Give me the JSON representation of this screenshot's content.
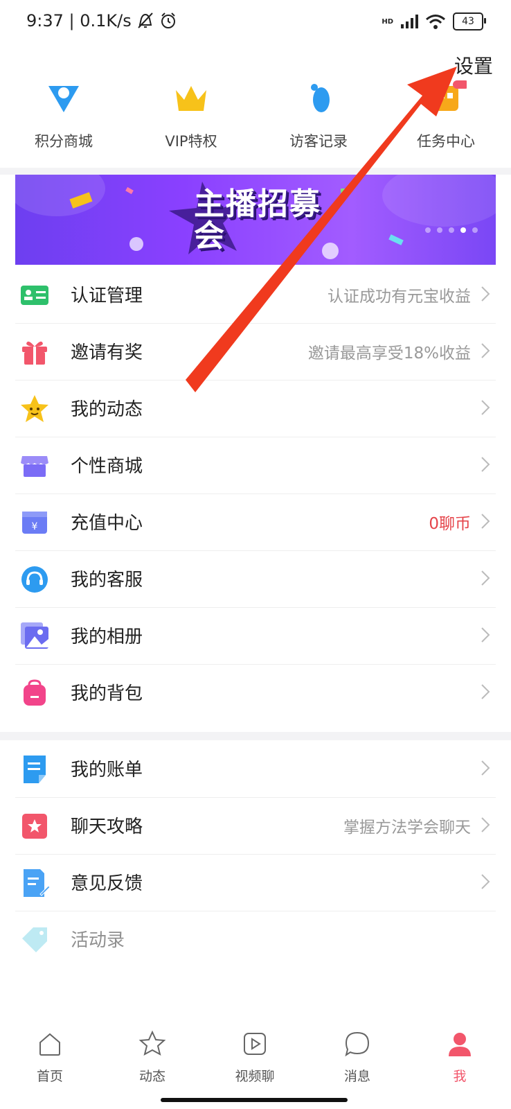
{
  "status_bar": {
    "time_speed": "9:37 | 0.1K/s",
    "network": "HD",
    "battery": "43"
  },
  "header": {
    "settings_label": "设置"
  },
  "quick_links": [
    {
      "label": "积分商城",
      "icon": "shop-heart-icon"
    },
    {
      "label": "VIP特权",
      "icon": "crown-icon"
    },
    {
      "label": "访客记录",
      "icon": "footprint-icon"
    },
    {
      "label": "任务中心",
      "icon": "task-icon"
    }
  ],
  "banner": {
    "title": "主播招募会",
    "dots": 5,
    "active_dot": 4
  },
  "menu_group_1": [
    {
      "label": "认证管理",
      "sub": "认证成功有元宝收益",
      "icon": "id-card-icon",
      "color": "#2ec06b"
    },
    {
      "label": "邀请有奖",
      "sub": "邀请最高享受18%收益",
      "icon": "gift-icon",
      "color": "#f2566b"
    },
    {
      "label": "我的动态",
      "sub": "",
      "icon": "star-face-icon",
      "color": "#f7c21a"
    },
    {
      "label": "个性商城",
      "sub": "",
      "icon": "store-icon",
      "color": "#7b6cf6"
    },
    {
      "label": "充值中心",
      "sub": "0聊币",
      "sub_highlight": true,
      "icon": "wallet-yen-icon",
      "color": "#6b7cf5"
    },
    {
      "label": "我的客服",
      "sub": "",
      "icon": "headset-icon",
      "color": "#2d9bf0"
    },
    {
      "label": "我的相册",
      "sub": "",
      "icon": "photo-album-icon",
      "color": "#6b6cf0"
    },
    {
      "label": "我的背包",
      "sub": "",
      "icon": "backpack-icon",
      "color": "#f2448a"
    }
  ],
  "menu_group_2": [
    {
      "label": "我的账单",
      "sub": "",
      "icon": "bill-icon",
      "color": "#2d9bf0"
    },
    {
      "label": "聊天攻略",
      "sub": "掌握方法学会聊天",
      "icon": "guide-book-icon",
      "color": "#f2566b"
    },
    {
      "label": "意见反馈",
      "sub": "",
      "icon": "feedback-icon",
      "color": "#4aa3f5"
    },
    {
      "label": "活动录",
      "sub": "",
      "icon": "tag-icon",
      "color": "#7fd6e8"
    }
  ],
  "tabbar": [
    {
      "label": "首页",
      "icon": "home-icon"
    },
    {
      "label": "动态",
      "icon": "star-icon"
    },
    {
      "label": "视频聊",
      "icon": "video-play-icon"
    },
    {
      "label": "消息",
      "icon": "message-icon"
    },
    {
      "label": "我",
      "icon": "profile-icon",
      "active": true
    }
  ],
  "colors": {
    "accent": "#f2566b",
    "arrow": "#f03a1e",
    "banner": "#7a47f5"
  }
}
